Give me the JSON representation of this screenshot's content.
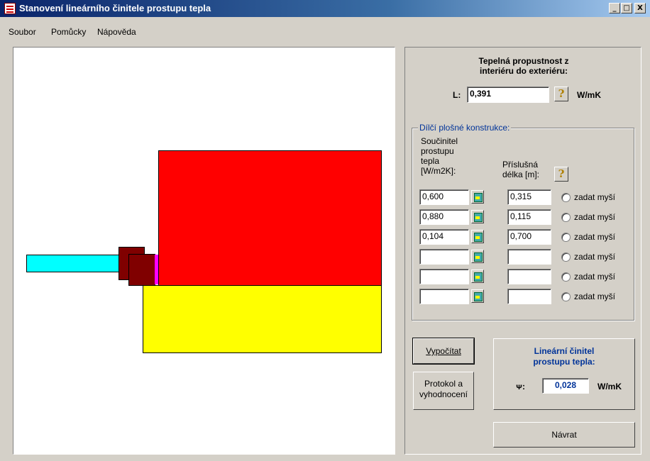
{
  "window": {
    "title": "Stanovení lineárního činitele prostupu tepla",
    "minimize_label": "_",
    "maximize_label": "□",
    "close_label": "X"
  },
  "menu": [
    "Soubor",
    "Pomůcky",
    "Nápověda"
  ],
  "result_top": {
    "heading": "Tepelná propustnost z",
    "heading_2": "interiéru do exteriéru:",
    "label": "L:",
    "value": "0,391",
    "unit": "W/mK",
    "help_icon": "help-question-icon"
  },
  "constructions": {
    "group_title": "Dílčí plošné konstrukce:",
    "col1_header": [
      "Součinitel",
      "prostupu",
      "tepla",
      "[W/m2K]:"
    ],
    "col2_header": [
      "Příslušná",
      "délka [m]:"
    ],
    "rows": [
      {
        "u": "0,600",
        "length": "0,315",
        "radio_label": "zadat myší"
      },
      {
        "u": "0,880",
        "length": "0,115",
        "radio_label": "zadat myší"
      },
      {
        "u": "0,104",
        "length": "0,700",
        "radio_label": "zadat myší"
      },
      {
        "u": "",
        "length": "",
        "radio_label": "zadat myší"
      },
      {
        "u": "",
        "length": "",
        "radio_label": "zadat myší"
      },
      {
        "u": "",
        "length": "",
        "radio_label": "zadat myší"
      }
    ]
  },
  "buttons": {
    "calculate": "Vypočítat",
    "report_1": "Protokol a",
    "report_2": "vyhodnocení",
    "back": "Návrat"
  },
  "result_bottom": {
    "heading_1": "Lineární činitel",
    "heading_2": "prostupu tepla:",
    "symbol": "ᴪ:",
    "value": "0,028",
    "unit": "W/mK"
  },
  "colors": {
    "red_block": "#ff0000",
    "yellow_block": "#ffff00",
    "cyan_bar": "#00ffff",
    "dark_red": "#800000",
    "magenta": "#ff00ff",
    "heading_blue": "#003399"
  }
}
